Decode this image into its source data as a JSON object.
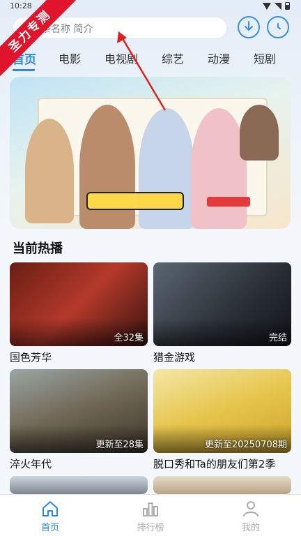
{
  "status_bar": {
    "time": "10:28"
  },
  "search": {
    "placeholder": "条名称 简介"
  },
  "ribbon": {
    "text": "圣力专测"
  },
  "tabs": [
    {
      "label": "首页",
      "active": true
    },
    {
      "label": "电影"
    },
    {
      "label": "电视剧"
    },
    {
      "label": "综艺"
    },
    {
      "label": "动漫"
    },
    {
      "label": "短剧"
    }
  ],
  "section": {
    "title": "当前热播"
  },
  "cards": [
    {
      "title": "国色芳华",
      "badge": "全32集"
    },
    {
      "title": "猎金游戏",
      "badge": "完结"
    },
    {
      "title": "淬火年代",
      "badge": "更新至28集"
    },
    {
      "title": "脱口秀和Ta的朋友们第2季",
      "badge": "更新至20250708期"
    }
  ],
  "bottom_nav": [
    {
      "label": "首页",
      "icon": "home-icon",
      "active": true
    },
    {
      "label": "排行榜",
      "icon": "ranking-icon"
    },
    {
      "label": "我的",
      "icon": "user-icon"
    }
  ],
  "colors": {
    "accent": "#2e86de",
    "ribbon": "#e0142a",
    "arrow": "#e02020"
  }
}
